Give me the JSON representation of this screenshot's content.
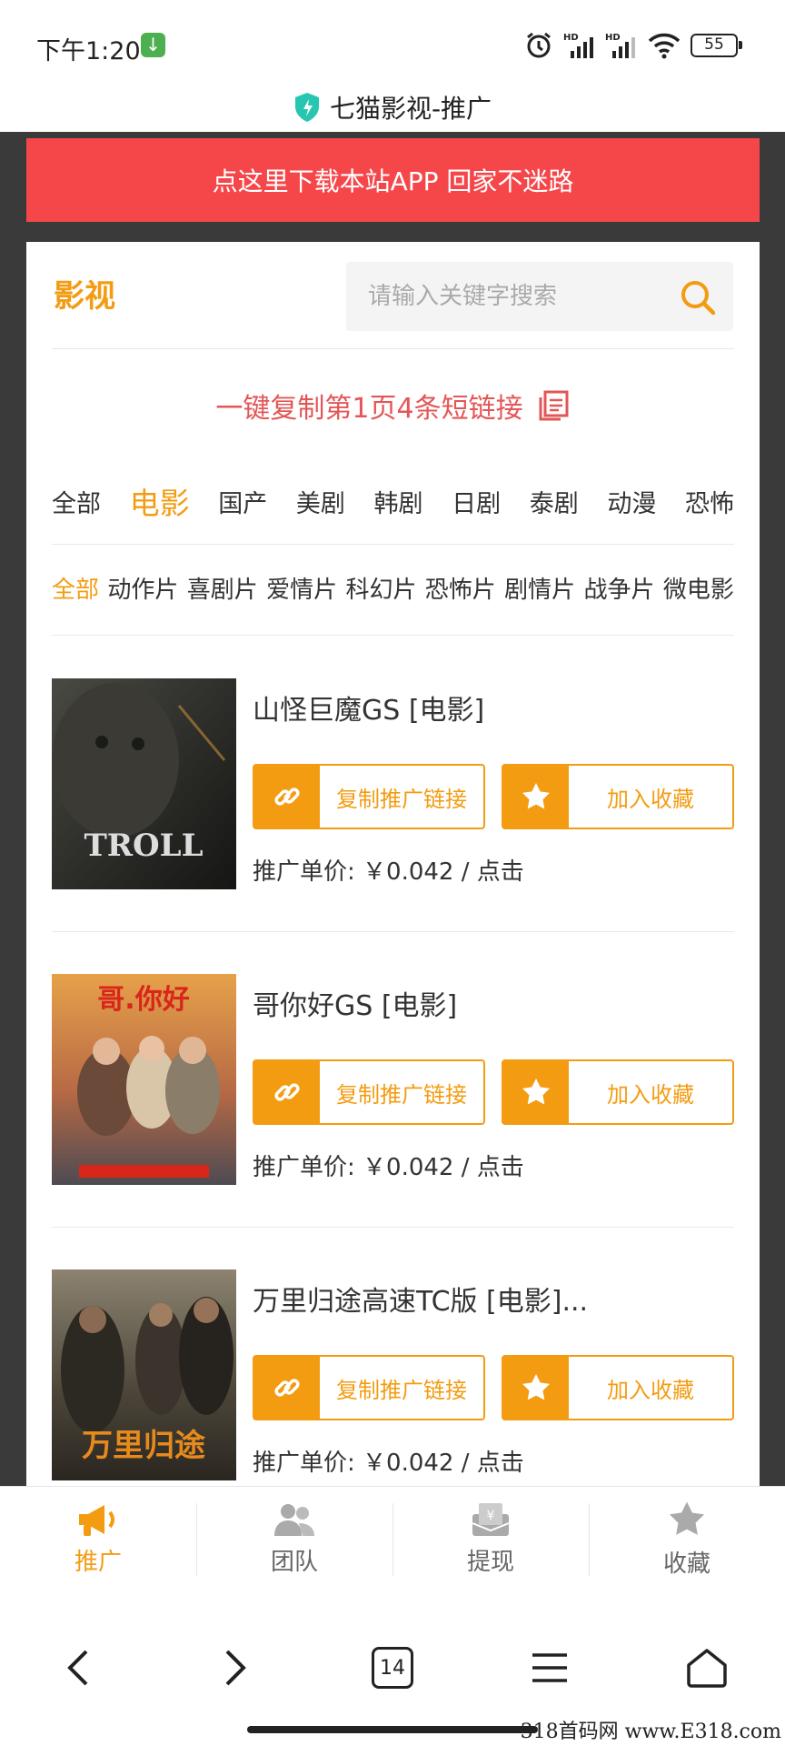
{
  "status_bar": {
    "time": "下午1:20",
    "battery": "55"
  },
  "address_bar": {
    "title": "七猫影视-推广"
  },
  "download_banner": "点这里下载本站APP 回家不迷路",
  "header": {
    "brand": "影视",
    "search_placeholder": "请输入关键字搜索"
  },
  "copy_all": "一键复制第1页4条短链接",
  "categories": [
    "全部",
    "电影",
    "国产",
    "美剧",
    "韩剧",
    "日剧",
    "泰剧",
    "动漫",
    "恐怖"
  ],
  "subcategories": [
    "全部",
    "动作片",
    "喜剧片",
    "爱情片",
    "科幻片",
    "恐怖片",
    "剧情片",
    "战争片",
    "微电影"
  ],
  "items": [
    {
      "title": "山怪巨魔GS [电影]",
      "copy_label": "复制推广链接",
      "fav_label": "加入收藏",
      "price": "推广单价: ￥0.042 / 点击",
      "poster_text": "TROLL"
    },
    {
      "title": "哥你好GS [电影]",
      "copy_label": "复制推广链接",
      "fav_label": "加入收藏",
      "price": "推广单价: ￥0.042 / 点击",
      "poster_text": "哥.你好"
    },
    {
      "title": "万里归途高速TC版 [电影]...",
      "copy_label": "复制推广链接",
      "fav_label": "加入收藏",
      "price": "推广单价: ￥0.042 / 点击",
      "poster_text": "万里归途"
    }
  ],
  "bottom_nav": [
    {
      "label": "推广",
      "icon": "megaphone-icon"
    },
    {
      "label": "团队",
      "icon": "team-icon"
    },
    {
      "label": "提现",
      "icon": "withdraw-icon"
    },
    {
      "label": "收藏",
      "icon": "star-icon"
    }
  ],
  "browser": {
    "tab_count": "14"
  },
  "watermark": "318首码网 www.E318.com",
  "colors": {
    "accent": "#f39c12",
    "banner": "#f5474a",
    "copy_text": "#e45656"
  }
}
